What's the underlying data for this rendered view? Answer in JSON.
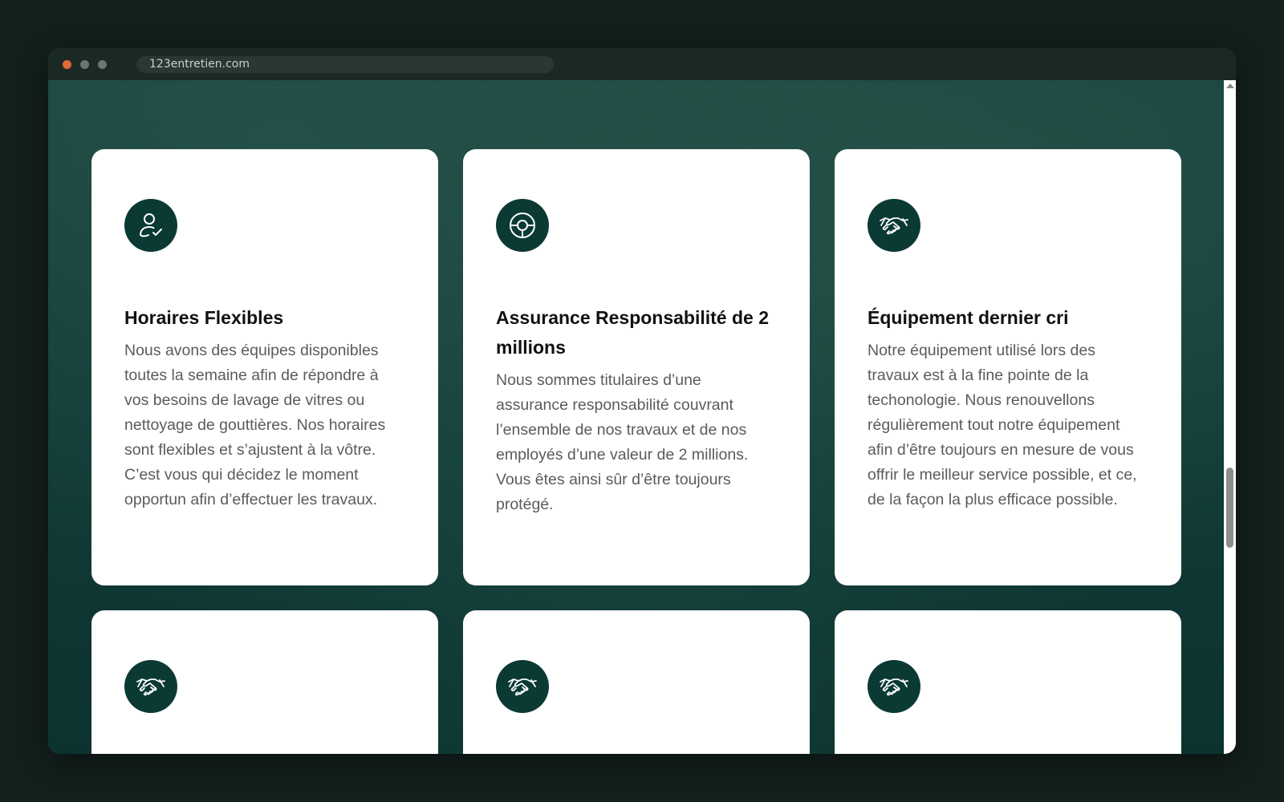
{
  "browser": {
    "url": "123entretien.com"
  },
  "cards": [
    {
      "icon": "person-check-icon",
      "title": "Horaires Flexibles",
      "text": "Nous avons des équipes disponibles toutes la semaine afin de répondre à vos besoins de lavage de vitres ou nettoyage de gouttières. Nos horaires sont flexibles et s’ajustent à la vôtre. C’est vous qui décidez le moment opportun afin d’effectuer les travaux."
    },
    {
      "icon": "steering-wheel-icon",
      "title": "Assurance Responsabilité de 2 millions",
      "text": "Nous sommes titulaires d’une assurance responsabilité couvrant l’ensemble de nos travaux et de nos employés d’une valeur de 2 millions. Vous êtes ainsi sûr d’être toujours protégé."
    },
    {
      "icon": "handshake-icon",
      "title": "Équipement dernier cri",
      "text": "Notre équipement utilisé lors des travaux est à la fine pointe de la techonologie. Nous renouvellons régulièrement tout notre équipement afin d’être toujours en mesure de vous offrir le meilleur service possible, et ce, de la façon la plus efficace possible."
    },
    {
      "icon": "handshake-icon"
    },
    {
      "icon": "handshake-icon"
    },
    {
      "icon": "handshake-icon"
    }
  ],
  "colors": {
    "icon_circle": "#0b3a35",
    "background": "#0f3a36",
    "card": "#ffffff"
  }
}
